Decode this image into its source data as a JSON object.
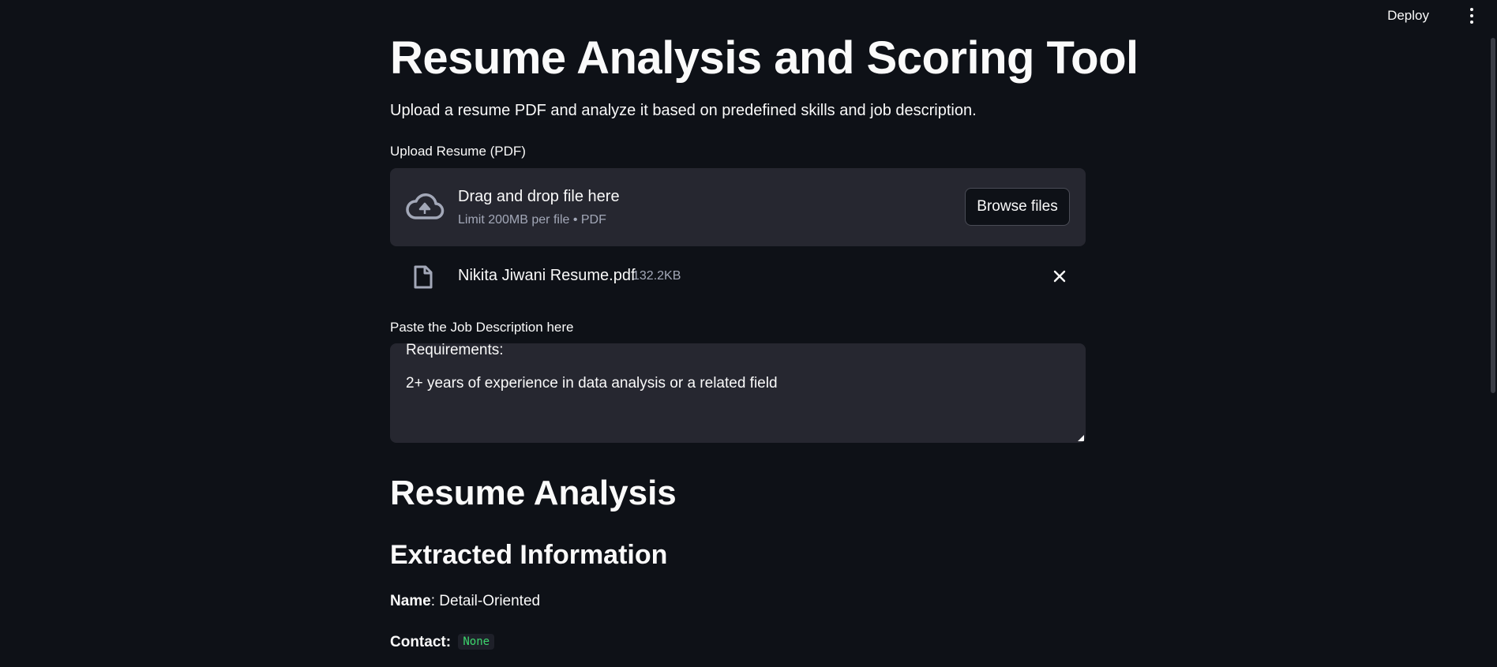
{
  "topbar": {
    "deploy_label": "Deploy",
    "menu_icon": "kebab-menu-icon"
  },
  "page": {
    "title": "Resume Analysis and Scoring Tool",
    "subtitle": "Upload a resume PDF and analyze it based on predefined skills and job description."
  },
  "uploader": {
    "label": "Upload Resume (PDF)",
    "drop_text": "Drag and drop file here",
    "limit_text": "Limit 200MB per file • PDF",
    "browse_label": "Browse files",
    "icon": "cloud-upload-icon"
  },
  "uploaded_file": {
    "name": "Nikita Jiwani Resume.pdf",
    "size": "132.2KB",
    "icon": "file-icon",
    "remove_icon": "close-icon"
  },
  "job_description": {
    "label": "Paste the Job Description here",
    "lines": [
      "Requirements:",
      "2+ years of experience in data analysis or a related field"
    ]
  },
  "analysis": {
    "heading": "Resume Analysis",
    "subheading": "Extracted Information",
    "name_label": "Name",
    "name_value": ": Detail-Oriented",
    "contact_label": "Contact",
    "contact_sep": ":",
    "contact_value": "None"
  },
  "colors": {
    "background": "#0e1117",
    "panel": "#262730",
    "text": "#fafafa",
    "muted": "#a3a8b8",
    "code_green": "#3dd56d"
  }
}
